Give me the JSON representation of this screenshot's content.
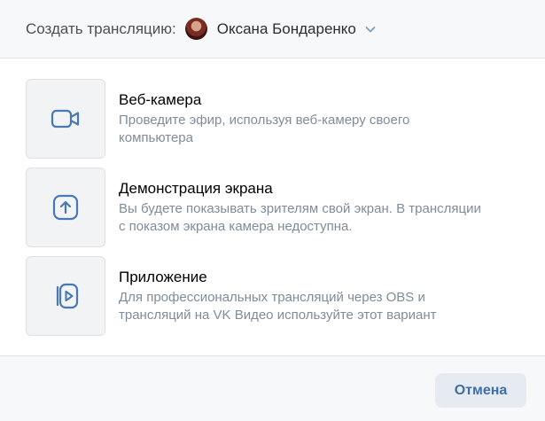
{
  "header": {
    "title": "Создать трансляцию:",
    "owner_name": "Оксана Бондаренко"
  },
  "options": [
    {
      "icon": "video-camera-icon",
      "title": "Веб-камера",
      "description_line1": "Проведите эфир, используя веб-камеру своего",
      "description_line2": "компьютера"
    },
    {
      "icon": "screen-share-icon",
      "title": "Демонстрация экрана",
      "description_line1": "Вы будете показывать зрителям свой экран. В трансляции",
      "description_line2": "с показом экрана камера недоступна."
    },
    {
      "icon": "app-play-icon",
      "title": "Приложение",
      "description_line1": "Для профессиональных трансляций через OBS и",
      "description_line2": "трансляций на VK Видео используйте этот вариант"
    }
  ],
  "footer": {
    "cancel_label": "Отмена"
  },
  "colors": {
    "accent": "#3f6fa8",
    "icon": "#4a78b5",
    "secondary_text": "#818c99"
  }
}
